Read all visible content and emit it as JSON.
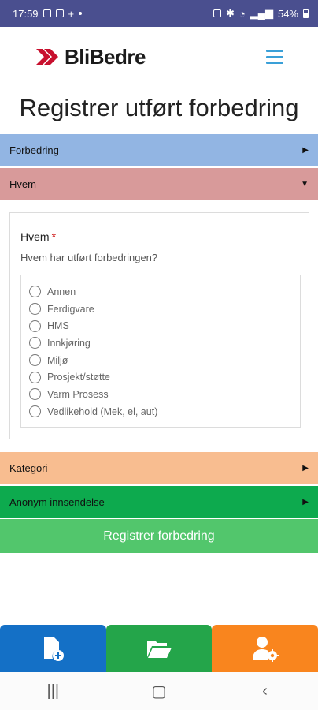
{
  "status_bar": {
    "time": "17:59",
    "battery": "54%"
  },
  "header": {
    "logo_text": "BliBedre"
  },
  "page_title": "Registrer utført forbedring",
  "accordions": {
    "forbedring": "Forbedring",
    "hvem": "Hvem",
    "kategori": "Kategori",
    "anonym": "Anonym innsendelse"
  },
  "question": {
    "label": "Hvem",
    "required_marker": "*",
    "description": "Hvem har utført forbedringen?",
    "options": [
      "Annen",
      "Ferdigvare",
      "HMS",
      "Innkjøring",
      "Miljø",
      "Prosjekt/støtte",
      "Varm Prosess",
      "Vedlikehold (Mek, el, aut)"
    ]
  },
  "submit_label": "Registrer forbedring",
  "colors": {
    "status_bar": "#4a4f8f",
    "forbedring": "#92b5e3",
    "hvem": "#d89a9a",
    "kategori": "#f8bd90",
    "anonym": "#0daa4e",
    "submit": "#52c66c",
    "tab_new": "#1470c6",
    "tab_folder": "#24a54a",
    "tab_user_settings": "#f9851e",
    "logo_red": "#c8102e",
    "hamburger": "#3aa0d8"
  },
  "icons": {
    "tab_new": "file-plus-icon",
    "tab_folder": "folder-open-icon",
    "tab_user_settings": "user-gear-icon"
  }
}
